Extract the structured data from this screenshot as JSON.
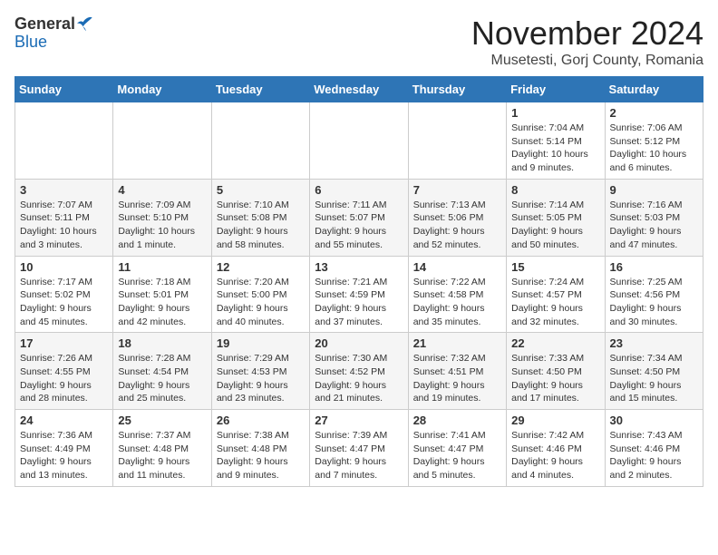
{
  "logo": {
    "general": "General",
    "blue": "Blue"
  },
  "title": "November 2024",
  "subtitle": "Musetesti, Gorj County, Romania",
  "days_of_week": [
    "Sunday",
    "Monday",
    "Tuesday",
    "Wednesday",
    "Thursday",
    "Friday",
    "Saturday"
  ],
  "weeks": [
    [
      {
        "day": "",
        "info": ""
      },
      {
        "day": "",
        "info": ""
      },
      {
        "day": "",
        "info": ""
      },
      {
        "day": "",
        "info": ""
      },
      {
        "day": "",
        "info": ""
      },
      {
        "day": "1",
        "info": "Sunrise: 7:04 AM\nSunset: 5:14 PM\nDaylight: 10 hours and 9 minutes."
      },
      {
        "day": "2",
        "info": "Sunrise: 7:06 AM\nSunset: 5:12 PM\nDaylight: 10 hours and 6 minutes."
      }
    ],
    [
      {
        "day": "3",
        "info": "Sunrise: 7:07 AM\nSunset: 5:11 PM\nDaylight: 10 hours and 3 minutes."
      },
      {
        "day": "4",
        "info": "Sunrise: 7:09 AM\nSunset: 5:10 PM\nDaylight: 10 hours and 1 minute."
      },
      {
        "day": "5",
        "info": "Sunrise: 7:10 AM\nSunset: 5:08 PM\nDaylight: 9 hours and 58 minutes."
      },
      {
        "day": "6",
        "info": "Sunrise: 7:11 AM\nSunset: 5:07 PM\nDaylight: 9 hours and 55 minutes."
      },
      {
        "day": "7",
        "info": "Sunrise: 7:13 AM\nSunset: 5:06 PM\nDaylight: 9 hours and 52 minutes."
      },
      {
        "day": "8",
        "info": "Sunrise: 7:14 AM\nSunset: 5:05 PM\nDaylight: 9 hours and 50 minutes."
      },
      {
        "day": "9",
        "info": "Sunrise: 7:16 AM\nSunset: 5:03 PM\nDaylight: 9 hours and 47 minutes."
      }
    ],
    [
      {
        "day": "10",
        "info": "Sunrise: 7:17 AM\nSunset: 5:02 PM\nDaylight: 9 hours and 45 minutes."
      },
      {
        "day": "11",
        "info": "Sunrise: 7:18 AM\nSunset: 5:01 PM\nDaylight: 9 hours and 42 minutes."
      },
      {
        "day": "12",
        "info": "Sunrise: 7:20 AM\nSunset: 5:00 PM\nDaylight: 9 hours and 40 minutes."
      },
      {
        "day": "13",
        "info": "Sunrise: 7:21 AM\nSunset: 4:59 PM\nDaylight: 9 hours and 37 minutes."
      },
      {
        "day": "14",
        "info": "Sunrise: 7:22 AM\nSunset: 4:58 PM\nDaylight: 9 hours and 35 minutes."
      },
      {
        "day": "15",
        "info": "Sunrise: 7:24 AM\nSunset: 4:57 PM\nDaylight: 9 hours and 32 minutes."
      },
      {
        "day": "16",
        "info": "Sunrise: 7:25 AM\nSunset: 4:56 PM\nDaylight: 9 hours and 30 minutes."
      }
    ],
    [
      {
        "day": "17",
        "info": "Sunrise: 7:26 AM\nSunset: 4:55 PM\nDaylight: 9 hours and 28 minutes."
      },
      {
        "day": "18",
        "info": "Sunrise: 7:28 AM\nSunset: 4:54 PM\nDaylight: 9 hours and 25 minutes."
      },
      {
        "day": "19",
        "info": "Sunrise: 7:29 AM\nSunset: 4:53 PM\nDaylight: 9 hours and 23 minutes."
      },
      {
        "day": "20",
        "info": "Sunrise: 7:30 AM\nSunset: 4:52 PM\nDaylight: 9 hours and 21 minutes."
      },
      {
        "day": "21",
        "info": "Sunrise: 7:32 AM\nSunset: 4:51 PM\nDaylight: 9 hours and 19 minutes."
      },
      {
        "day": "22",
        "info": "Sunrise: 7:33 AM\nSunset: 4:50 PM\nDaylight: 9 hours and 17 minutes."
      },
      {
        "day": "23",
        "info": "Sunrise: 7:34 AM\nSunset: 4:50 PM\nDaylight: 9 hours and 15 minutes."
      }
    ],
    [
      {
        "day": "24",
        "info": "Sunrise: 7:36 AM\nSunset: 4:49 PM\nDaylight: 9 hours and 13 minutes."
      },
      {
        "day": "25",
        "info": "Sunrise: 7:37 AM\nSunset: 4:48 PM\nDaylight: 9 hours and 11 minutes."
      },
      {
        "day": "26",
        "info": "Sunrise: 7:38 AM\nSunset: 4:48 PM\nDaylight: 9 hours and 9 minutes."
      },
      {
        "day": "27",
        "info": "Sunrise: 7:39 AM\nSunset: 4:47 PM\nDaylight: 9 hours and 7 minutes."
      },
      {
        "day": "28",
        "info": "Sunrise: 7:41 AM\nSunset: 4:47 PM\nDaylight: 9 hours and 5 minutes."
      },
      {
        "day": "29",
        "info": "Sunrise: 7:42 AM\nSunset: 4:46 PM\nDaylight: 9 hours and 4 minutes."
      },
      {
        "day": "30",
        "info": "Sunrise: 7:43 AM\nSunset: 4:46 PM\nDaylight: 9 hours and 2 minutes."
      }
    ]
  ]
}
